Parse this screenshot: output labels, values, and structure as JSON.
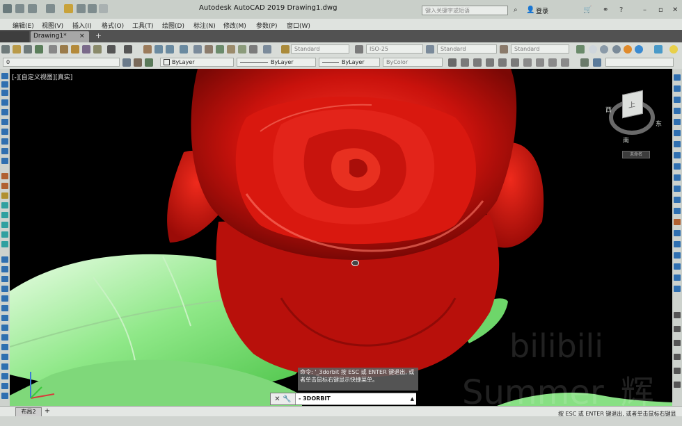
{
  "app": {
    "title": "Autodesk AutoCAD 2019    Drawing1.dwg",
    "search_placeholder": "键入关键字或短语",
    "login_label": "登录"
  },
  "menu": {
    "items": [
      "编辑(E)",
      "视图(V)",
      "插入(I)",
      "格式(O)",
      "工具(T)",
      "绘图(D)",
      "标注(N)",
      "修改(M)",
      "参数(P)",
      "窗口(W)"
    ]
  },
  "tabs": {
    "drawing_label": "Drawing1*",
    "close_glyph": "×",
    "add_glyph": "+"
  },
  "toolbar1": {
    "text_style": "Standard",
    "dim_style": "ISO-25",
    "table_style": "Standard",
    "mleader_style": "Standard"
  },
  "toolbar2": {
    "layer": "0",
    "color": "ByLayer",
    "linetype": "ByLayer",
    "lineweight": "ByLayer",
    "plotstyle": "ByColor"
  },
  "viewport": {
    "label": "[-][自定义视图][真实]",
    "viewcube": {
      "top": "上",
      "west": "西",
      "east": "东",
      "south": "南",
      "menu": "未命名"
    }
  },
  "scene": {
    "rose_color": "#d4140f",
    "leaf_color": "#7fe07a"
  },
  "watermark": {
    "line1": "bilibili",
    "line2": "Summer_辉"
  },
  "command": {
    "history": "命令: '_3dorbit 按 ESC 或 ENTER 键退出, 或者单击鼠标右键显示快捷菜单。",
    "input": "- 3DORBIT"
  },
  "status": {
    "layout_tab": "布局2",
    "add_glyph": "+",
    "message": "按 ESC 或 ENTER 键退出, 或者单击鼠标右键显"
  }
}
